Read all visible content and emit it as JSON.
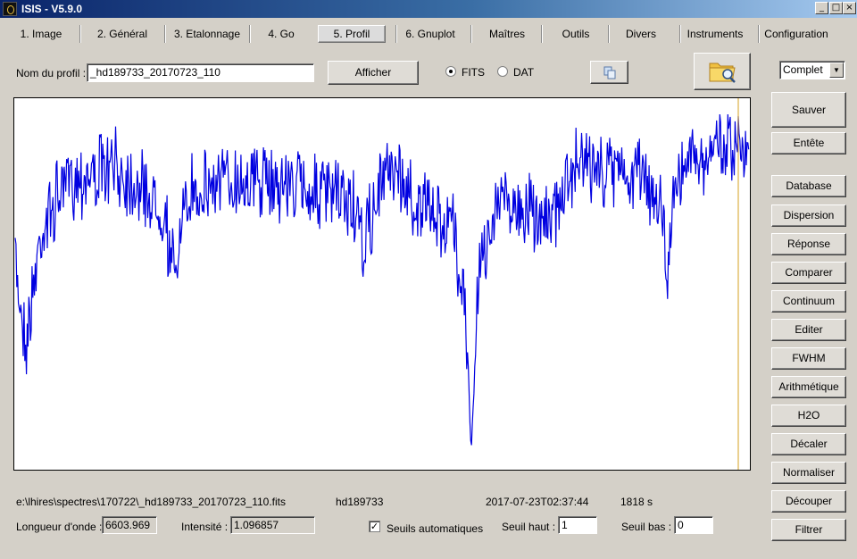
{
  "window": {
    "title": "ISIS - V5.9.0"
  },
  "tabs": [
    {
      "label": "1. Image"
    },
    {
      "label": "2. Général"
    },
    {
      "label": "3. Etalonnage"
    },
    {
      "label": "4. Go"
    },
    {
      "label": "5. Profil"
    },
    {
      "label": "6. Gnuplot"
    },
    {
      "label": "Maîtres"
    },
    {
      "label": "Outils"
    },
    {
      "label": "Divers"
    },
    {
      "label": "Instruments"
    },
    {
      "label": "Configuration"
    }
  ],
  "profile": {
    "name_label": "Nom du profil :",
    "name_value": "_hd189733_20170723_110",
    "show_button": "Afficher",
    "format_fits": "FITS",
    "format_dat": "DAT",
    "selected_format": "FITS",
    "mode_select": "Complet"
  },
  "side_buttons": [
    {
      "label": "Sauver"
    },
    {
      "label": "Entête"
    },
    {
      "label": "Database"
    },
    {
      "label": "Dispersion"
    },
    {
      "label": "Réponse"
    },
    {
      "label": "Comparer"
    },
    {
      "label": "Continuum"
    },
    {
      "label": "Editer"
    },
    {
      "label": "FWHM"
    },
    {
      "label": "Arithmétique"
    },
    {
      "label": "H2O"
    },
    {
      "label": "Décaler"
    },
    {
      "label": "Normaliser"
    },
    {
      "label": "Découper"
    },
    {
      "label": "Filtrer"
    }
  ],
  "info": {
    "file_path": "e:\\lhires\\spectres\\170722\\_hd189733_20170723_110.fits",
    "object": "hd189733",
    "date": "2017-07-23T02:37:44",
    "exposure": "1818 s"
  },
  "readout": {
    "wavelength_label": "Longueur d'onde :",
    "wavelength_value": "6603.969",
    "intensity_label": "Intensité :",
    "intensity_value": "1.096857",
    "auto_threshold_label": "Seuils automatiques",
    "auto_threshold_checked": true,
    "high_threshold_label": "Seuil haut :",
    "high_threshold_value": "1",
    "low_threshold_label": "Seuil bas :",
    "low_threshold_value": "0"
  },
  "plot": {
    "line_color": "#0000e0",
    "cursor_color": "#d4a020"
  }
}
